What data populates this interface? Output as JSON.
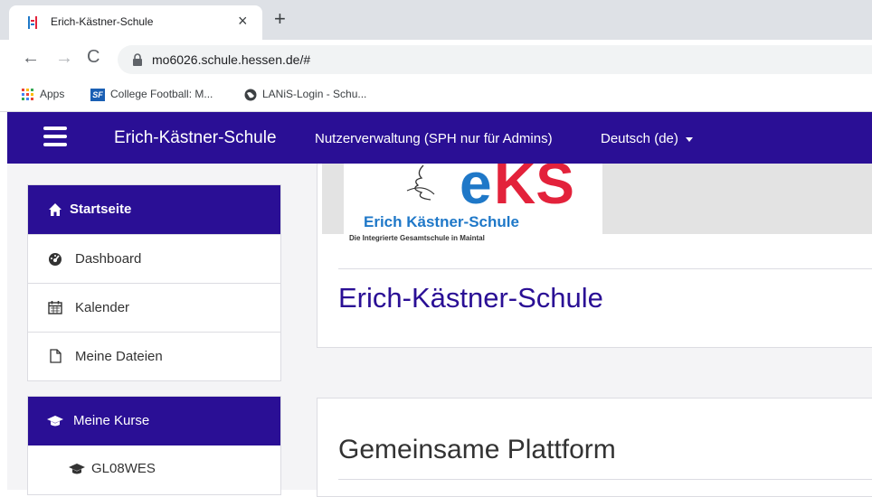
{
  "browser": {
    "tab_title": "Erich-Kästner-Schule",
    "close_glyph": "×",
    "newtab_glyph": "+",
    "url": "mo6026.schule.hessen.de/#",
    "back_glyph": "←",
    "forward_glyph": "→",
    "reload_glyph": "C",
    "bookmarks": [
      {
        "label": "Apps",
        "icon": "apps-grid-icon"
      },
      {
        "label": "College Football: M...",
        "icon": "sf-icon"
      },
      {
        "label": "LANiS-Login - Schu...",
        "icon": "globe-icon"
      }
    ],
    "sf_badge": "SF"
  },
  "navbar": {
    "brand": "Erich-Kästner-Schule",
    "link_admin": "Nutzerverwaltung (SPH nur für Admins)",
    "language": "Deutsch (de)",
    "color": "#2a0f95"
  },
  "sidebar": {
    "home_label": "Startseite",
    "items": [
      {
        "label": "Dashboard",
        "icon": "dashboard-icon"
      },
      {
        "label": "Kalender",
        "icon": "calendar-icon"
      },
      {
        "label": "Meine Dateien",
        "icon": "file-icon"
      }
    ],
    "courses_label": "Meine Kurse",
    "courses": [
      {
        "label": "GL08WES",
        "icon": "graduation-cap-icon"
      }
    ]
  },
  "main": {
    "logo_caption": "Erich Kästner-Schule",
    "logo_subcaption": "Die Integrierte Gesamtschule in Maintal",
    "page_title": "Erich-Kästner-Schule",
    "section_title": "Gemeinsame Plattform"
  },
  "colors": {
    "brand_purple": "#2a0f95",
    "logo_blue": "#1f78c8",
    "logo_red": "#e3223b"
  }
}
